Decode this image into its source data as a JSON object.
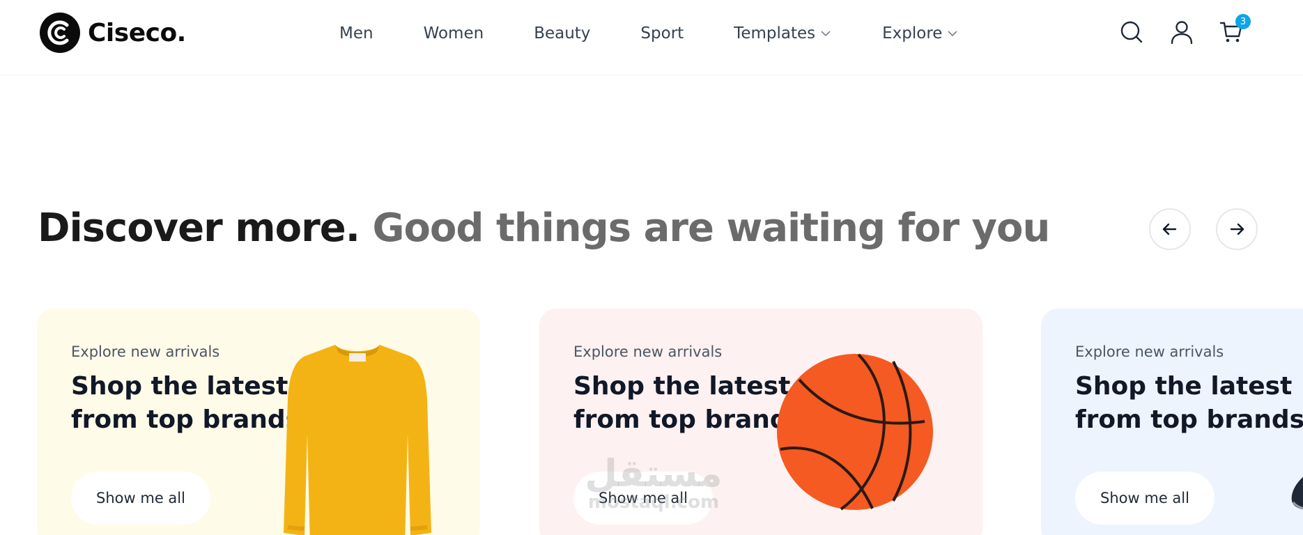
{
  "brand": {
    "name": "Ciseco."
  },
  "nav": {
    "items": [
      {
        "label": "Men"
      },
      {
        "label": "Women"
      },
      {
        "label": "Beauty"
      },
      {
        "label": "Sport"
      },
      {
        "label": "Templates"
      },
      {
        "label": "Explore"
      }
    ]
  },
  "header": {
    "cart_count": "3",
    "accent_color": "#0ea5e9"
  },
  "section": {
    "title_strong": "Discover more.",
    "title_muted": "Good things are waiting for you"
  },
  "cards": [
    {
      "eyebrow": "Explore new arrivals",
      "title_line1": "Shop the latest",
      "title_line2": "from top brands",
      "button": "Show me all",
      "bg": "#fefbe8",
      "product_icon": "sweater"
    },
    {
      "eyebrow": "Explore new arrivals",
      "title_line1": "Shop the latest",
      "title_line2": "from top brands",
      "button": "Show me all",
      "bg": "#fef1f1",
      "product_icon": "basketball"
    },
    {
      "eyebrow": "Explore new arrivals",
      "title_line1": "Shop the latest",
      "title_line2": "from top brands",
      "button": "Show me all",
      "bg": "#edf4fe",
      "product_icon": "shoe"
    }
  ],
  "watermark": {
    "arabic": "مستقل",
    "latin": "mostaql.com"
  }
}
